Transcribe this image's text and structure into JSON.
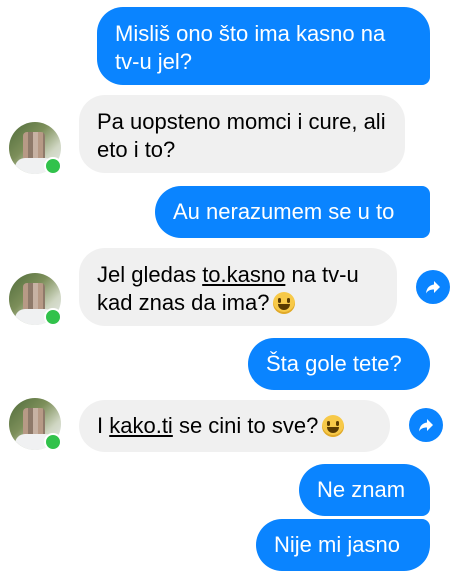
{
  "messages": [
    {
      "id": "m1",
      "direction": "outgoing",
      "text": "Misliš ono što ima kasno na tv-u jel?"
    },
    {
      "id": "m2",
      "direction": "incoming",
      "text": "Pa uopsteno momci i cure, ali eto i to?"
    },
    {
      "id": "m3",
      "direction": "outgoing",
      "text": "Au nerazumem se u to"
    },
    {
      "id": "m4",
      "direction": "incoming",
      "before": "Jel gledas ",
      "link": "to.kasno",
      "after": " na tv-u kad znas da ima?",
      "emoji": "grinning-emoji"
    },
    {
      "id": "m5",
      "direction": "outgoing",
      "text": "Šta gole tete?"
    },
    {
      "id": "m6",
      "direction": "incoming",
      "before": "I ",
      "link": "kako.ti",
      "after": " se cini to sve?",
      "emoji": "grinning-emoji"
    },
    {
      "id": "m7",
      "direction": "outgoing",
      "text": "Ne znam"
    },
    {
      "id": "m8",
      "direction": "outgoing",
      "text": "Nije mi jasno"
    }
  ],
  "icons": {
    "avatar": "blurred-profile-photo",
    "status": "online-dot-icon",
    "share": "share-arrow-icon"
  },
  "colors": {
    "outgoing_bubble": "#0a84ff",
    "incoming_bubble": "#f0f0f0",
    "online": "#31c24b",
    "share_button": "#0a84ff"
  }
}
